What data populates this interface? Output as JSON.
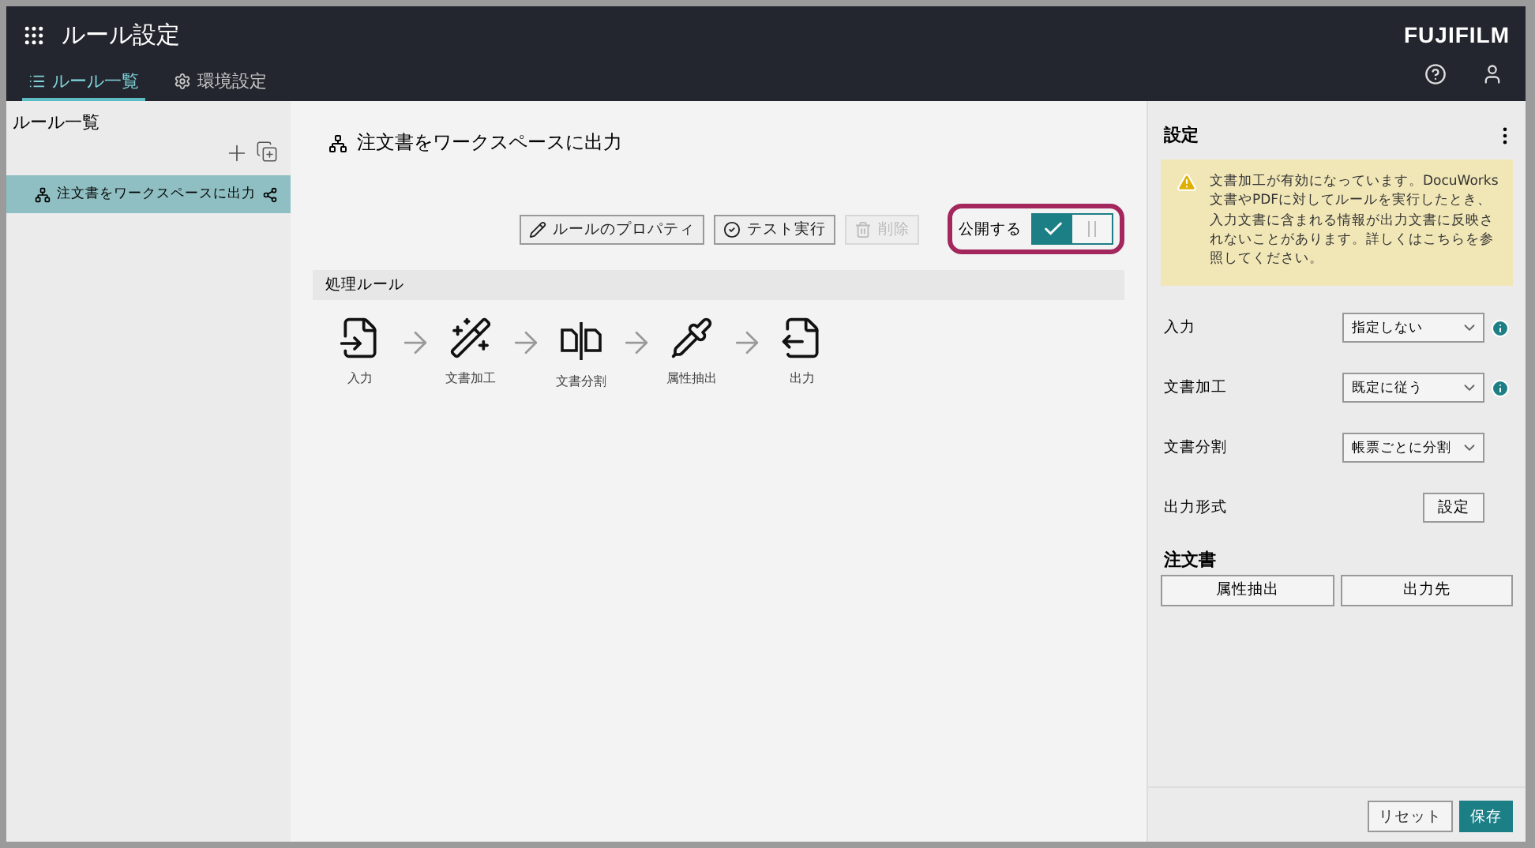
{
  "app": {
    "title": "ルール設定",
    "brand": "FUJIFILM"
  },
  "tabs": [
    {
      "label": "ルール一覧",
      "kind": "list",
      "selected": true
    },
    {
      "label": "環境設定",
      "kind": "gear",
      "selected": false
    }
  ],
  "sidebar": {
    "title": "ルール一覧",
    "items": [
      {
        "label": "注文書をワークスペースに出力",
        "selected": true
      }
    ]
  },
  "rule": {
    "title": "注文書をワークスペースに出力",
    "actions": [
      {
        "label": "ルールのプロパティ",
        "kind": "edit",
        "disabled": false
      },
      {
        "label": "テスト実行",
        "kind": "test",
        "disabled": false
      },
      {
        "label": "削除",
        "kind": "delete",
        "disabled": true
      }
    ],
    "publish": {
      "label": "公開する",
      "on": true,
      "highlighted": true
    },
    "section": "処理ルール",
    "steps": [
      {
        "label": "入力",
        "kind": "input"
      },
      {
        "label": "文書加工",
        "kind": "process"
      },
      {
        "label": "文書分割",
        "kind": "split"
      },
      {
        "label": "属性抽出",
        "kind": "extract"
      },
      {
        "label": "出力",
        "kind": "output"
      }
    ]
  },
  "settings": {
    "title": "設定",
    "warning": "文書加工が有効になっています。DocuWorks文書やPDFに対してルールを実行したとき、入力文書に含まれる情報が出力文書に反映されないことがあります。詳しくはこちらを参照してください。",
    "rows": [
      {
        "label": "入力",
        "kind": "select",
        "value": "指定しない",
        "info": true
      },
      {
        "label": "文書加工",
        "kind": "select",
        "value": "既定に従う",
        "info": true
      },
      {
        "label": "文書分割",
        "kind": "select",
        "value": "帳票ごとに分割",
        "info": false
      },
      {
        "label": "出力形式",
        "kind": "button",
        "value": "設定",
        "info": false
      }
    ],
    "group": {
      "title": "注文書",
      "buttons": [
        "属性抽出",
        "出力先"
      ]
    },
    "footer": [
      {
        "label": "リセット",
        "primary": false
      },
      {
        "label": "保存",
        "primary": true
      }
    ]
  }
}
